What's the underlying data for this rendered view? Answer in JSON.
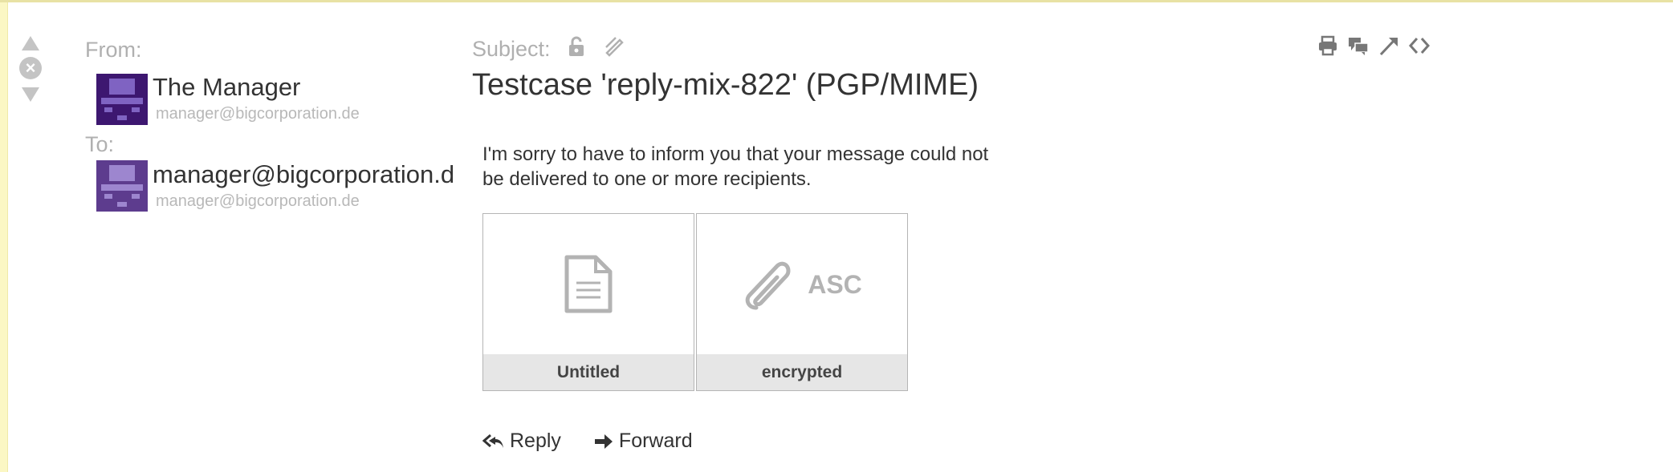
{
  "header": {
    "from_label": "From:",
    "to_label": "To:",
    "subject_label": "Subject:"
  },
  "from": {
    "name": "The Manager",
    "email": "manager@bigcorporation.de"
  },
  "to": {
    "name": "manager@bigcorporation.de",
    "email": "manager@bigcorporation.de"
  },
  "subject": "Testcase 'reply-mix-822' (PGP/MIME)",
  "body": "I'm sorry to have to inform you that your message could not be delivered to one or more recipients.",
  "attachments": [
    {
      "caption": "Untitled",
      "icon": "document-icon",
      "type_label": ""
    },
    {
      "caption": "encrypted",
      "icon": "paperclip-icon",
      "type_label": "ASC"
    }
  ],
  "actions": {
    "reply_label": "Reply",
    "forward_label": "Forward"
  },
  "colors": {
    "stripe": "#fbf7c4",
    "avatar_dark": "#3d1770",
    "avatar_light": "#5d3c8e",
    "muted": "#b0b0b0"
  },
  "icons": {
    "toolbar": [
      "print-icon",
      "conversation-icon",
      "pin-icon",
      "source-code-icon"
    ],
    "subject": [
      "unlock-icon",
      "unsigned-icon"
    ],
    "nav": [
      "previous-arrow-icon",
      "close-icon",
      "next-arrow-icon"
    ]
  }
}
